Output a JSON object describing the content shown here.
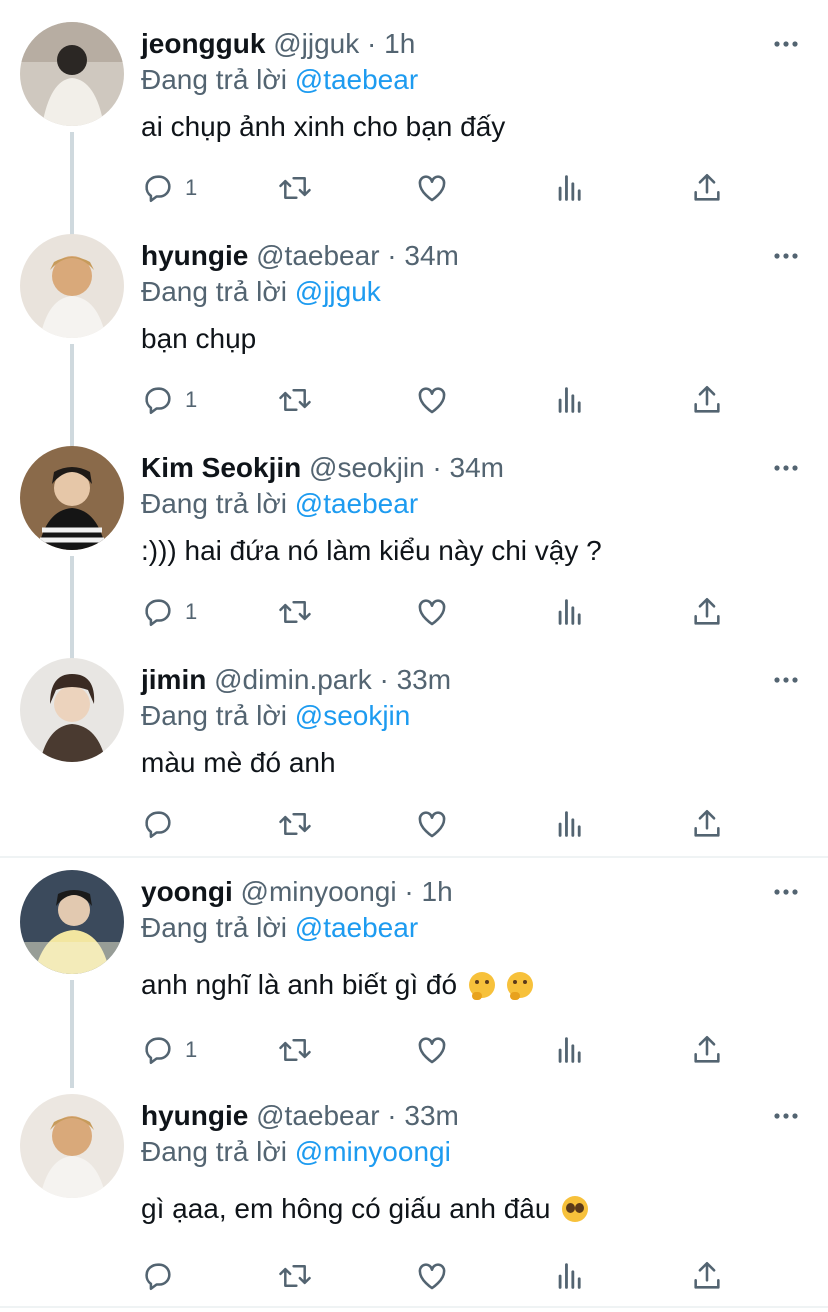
{
  "colors": {
    "accent": "#1d9bf0",
    "secondary": "#536471",
    "thread_line": "#cfd9de"
  },
  "reply_prefix": "Đang trả lời",
  "tweets": [
    {
      "name": "jeongguk",
      "handle": "@jjguk",
      "time": "1h",
      "replying_to": "@taebear",
      "text": "ai chụp ảnh xinh cho bạn đấy",
      "reply_count": "1"
    },
    {
      "name": "hyungie",
      "handle": "@taebear",
      "time": "34m",
      "replying_to": "@jjguk",
      "text": "bạn chụp",
      "reply_count": "1"
    },
    {
      "name": "Kim Seokjin",
      "handle": "@seokjin",
      "time": "34m",
      "replying_to": "@taebear",
      "text": ":))) hai đứa nó làm kiểu này chi vậy ?",
      "reply_count": "1"
    },
    {
      "name": "jimin",
      "handle": "@dimin.park",
      "time": "33m",
      "replying_to": "@seokjin",
      "text": "màu mè đó anh",
      "reply_count": ""
    },
    {
      "name": "yoongi",
      "handle": "@minyoongi",
      "time": "1h",
      "replying_to": "@taebear",
      "text": "anh nghĩ là anh biết gì đó",
      "reply_count": "1"
    },
    {
      "name": "hyungie",
      "handle": "@taebear",
      "time": "33m",
      "replying_to": "@minyoongi",
      "text": "gì ạaa, em hông có giấu anh đâu",
      "reply_count": ""
    }
  ],
  "icons": [
    "reply-icon",
    "retweet-icon",
    "like-icon",
    "analytics-icon",
    "share-icon",
    "more-icon"
  ]
}
